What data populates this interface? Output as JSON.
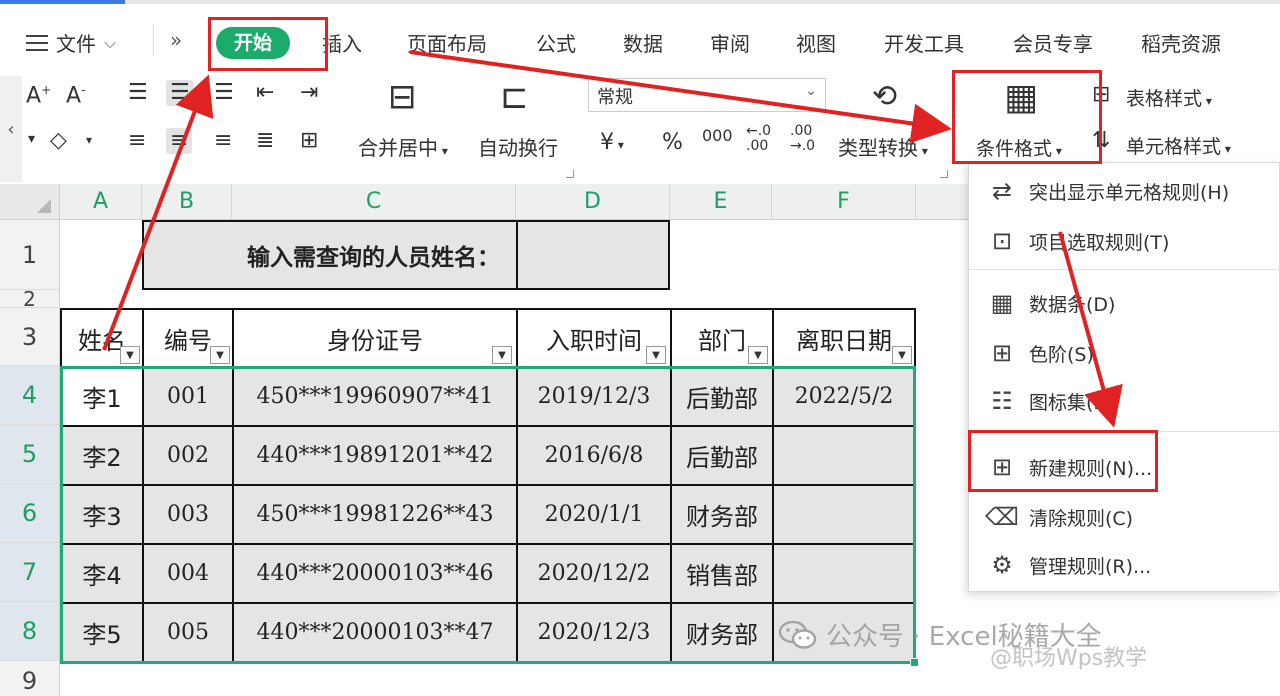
{
  "menu": {
    "file": "文件",
    "more": "»",
    "tabs": [
      "开始",
      "插入",
      "页面布局",
      "公式",
      "数据",
      "审阅",
      "视图",
      "开发工具",
      "会员专享",
      "稻壳资源"
    ]
  },
  "ribbon": {
    "merge_center": "合并居中",
    "wrap_text": "自动换行",
    "number_format": "常规",
    "currency": "¥",
    "percent": "%",
    "thousands": "000",
    "type_convert": "类型转换",
    "conditional_format": "条件格式",
    "table_style": "表格样式",
    "cell_style": "单元格样式"
  },
  "sheet": {
    "columns": [
      "A",
      "B",
      "C",
      "D",
      "E",
      "F"
    ],
    "rows": [
      "1",
      "2",
      "3",
      "4",
      "5",
      "6",
      "7",
      "8",
      "9"
    ],
    "prompt_label": "输入需查询的人员姓名：",
    "headers": [
      "姓名",
      "编号",
      "身份证号",
      "入职时间",
      "部门",
      "离职日期"
    ],
    "data": [
      [
        "李1",
        "001",
        "450***19960907**41",
        "2019/12/3",
        "后勤部",
        "2022/5/2"
      ],
      [
        "李2",
        "002",
        "440***19891201**42",
        "2016/6/8",
        "后勤部",
        ""
      ],
      [
        "李3",
        "003",
        "450***19981226**43",
        "2020/1/1",
        "财务部",
        ""
      ],
      [
        "李4",
        "004",
        "440***20000103**46",
        "2020/12/2",
        "销售部",
        ""
      ],
      [
        "李5",
        "005",
        "440***20000103**47",
        "2020/12/3",
        "财务部",
        ""
      ]
    ]
  },
  "cf_menu": {
    "items": [
      "突出显示单元格规则(H)",
      "项目选取规则(T)",
      "数据条(D)",
      "色阶(S)",
      "图标集(I)",
      "新建规则(N)...",
      "清除规则(C)",
      "管理规则(R)..."
    ]
  },
  "watermark": {
    "text": "公众号 · Excel秘籍大全",
    "sub": "@职场Wps教学"
  },
  "colors": {
    "accent_green": "#1bab6b",
    "selection": "#1faa78",
    "annotation_red": "#e02222"
  }
}
